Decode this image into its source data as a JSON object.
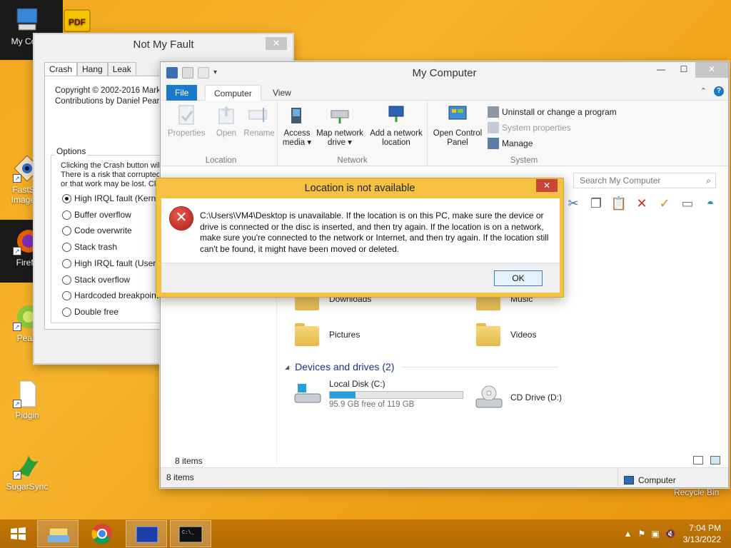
{
  "desktop": {
    "icons": [
      {
        "label": "My Com"
      },
      {
        "label": "FastSto"
      },
      {
        "label": "Image V"
      },
      {
        "label": "Firefo"
      },
      {
        "label": "PeaZ"
      },
      {
        "label": "Pidgin"
      },
      {
        "label": "SugarSync"
      },
      {
        "label": "Recycle Bin"
      }
    ],
    "pdf_label": "PDF"
  },
  "notmyfault": {
    "title": "Not My Fault",
    "tabs": [
      "Crash",
      "Hang",
      "Leak"
    ],
    "copyright": "Copyright © 2002-2016 Mark R",
    "contrib": "Contributions by Daniel Pearso",
    "options_legend": "Options",
    "desc": [
      "Clicking the Crash button will",
      "There is a risk that corrupted",
      "or that work may be lost. Clo"
    ],
    "options": [
      {
        "label": "High IRQL fault (Kernel-mo",
        "selected": true
      },
      {
        "label": "Buffer overflow",
        "selected": false
      },
      {
        "label": "Code overwrite",
        "selected": false
      },
      {
        "label": "Stack trash",
        "selected": false
      },
      {
        "label": "High IRQL fault (User-mo",
        "selected": false
      },
      {
        "label": "Stack overflow",
        "selected": false
      },
      {
        "label": "Hardcoded breakpoint",
        "selected": false
      },
      {
        "label": "Double free",
        "selected": false
      }
    ],
    "close_glyph": "✕"
  },
  "explorer": {
    "title": "My Computer",
    "ribbon_tabs": {
      "file": "File",
      "computer": "Computer",
      "view": "View"
    },
    "groups": {
      "location": {
        "label": "Location",
        "properties": "Properties",
        "open": "Open",
        "rename": "Rename"
      },
      "network": {
        "label": "Network",
        "access_media": "Access",
        "access_media2": "media ▾",
        "map_drive": "Map network",
        "map_drive2": "drive ▾",
        "add_location": "Add a network",
        "add_location2": "location"
      },
      "system": {
        "label": "System",
        "open_cp": "Open Control",
        "open_cp2": "Panel",
        "uninstall": "Uninstall or change a program",
        "sysprops": "System properties",
        "manage": "Manage"
      }
    },
    "address_partial": "My Computer",
    "search_placeholder": "Search My Computer",
    "folders": [
      {
        "name": "Downloads"
      },
      {
        "name": "Music"
      },
      {
        "name": "Pictures"
      },
      {
        "name": "Videos"
      }
    ],
    "devices_header": "Devices and drives (2)",
    "drives": [
      {
        "name": "Local Disk (C:)",
        "free": "95.9 GB free of 119 GB",
        "used_fraction": 0.194
      },
      {
        "name": "CD Drive (D:)"
      }
    ],
    "items_count_inner": "8 items",
    "status_left": "8 items",
    "status_right": "Computer"
  },
  "error_dialog": {
    "title": "Location is not available",
    "message": "C:\\Users\\VM4\\Desktop is unavailable. If the location is on this PC, make sure the device or drive is connected or the disc is inserted, and then try again. If the location is on a network, make sure you're connected to the network or Internet, and then try again. If the location still can't be found, it might have been moved or deleted.",
    "ok_label": "OK",
    "close_glyph": "✕"
  },
  "taskbar": {
    "time": "7:04 PM",
    "date": "3/13/2022"
  }
}
